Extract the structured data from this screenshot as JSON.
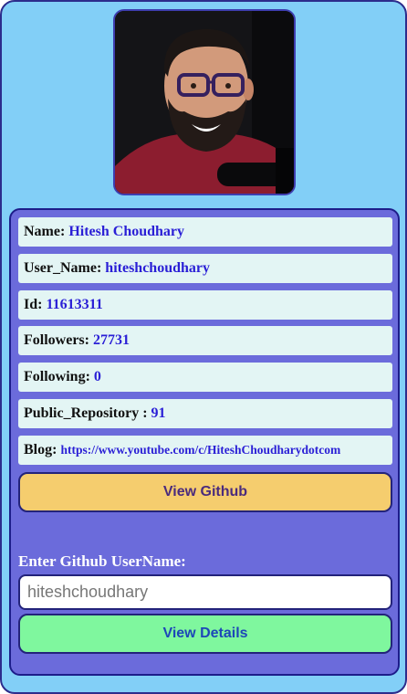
{
  "profile": {
    "avatar_alt": "Hitesh Choudhary profile photo",
    "fields": [
      {
        "label": "Name:",
        "value": "Hitesh Choudhary"
      },
      {
        "label": "User_Name:",
        "value": "hiteshchoudhary"
      },
      {
        "label": "Id:",
        "value": "11613311"
      },
      {
        "label": "Followers:",
        "value": "27731"
      },
      {
        "label": "Following:",
        "value": "0"
      },
      {
        "label": "Public_Repository :",
        "value": "91"
      },
      {
        "label": "Blog:",
        "value": "https://www.youtube.com/c/HiteshChoudharydotcom"
      }
    ],
    "view_github_label": "View Github"
  },
  "search": {
    "label": "Enter Github UserName:",
    "value": "hiteshchoudhary",
    "button_label": "View Details"
  },
  "colors": {
    "page_background": "#82cff7",
    "panel_background": "#6b6bdb",
    "row_background": "#e3f5f4",
    "value_text": "#2a1fd6",
    "github_button": "#f5cd6e",
    "details_button": "#7ff79e"
  }
}
